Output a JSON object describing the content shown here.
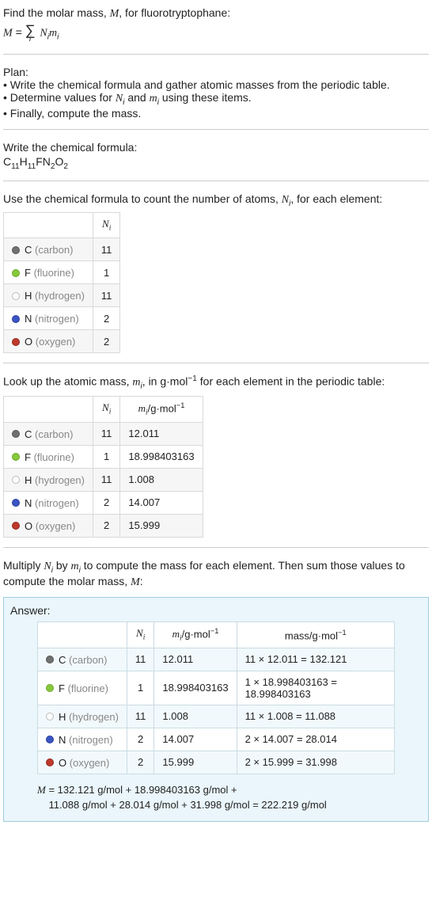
{
  "intro": {
    "line1_pre": "Find the molar mass, ",
    "line1_mid": ", for fluorotryptophane:"
  },
  "plan": {
    "heading": "Plan:",
    "items": [
      "Write the chemical formula and gather atomic masses from the periodic table.",
      "Determine values for Nᵢ and mᵢ using these items.",
      "Finally, compute the mass."
    ]
  },
  "formula_section": {
    "heading": "Write the chemical formula:",
    "formula_parts": [
      "C",
      "11",
      "H",
      "11",
      "F",
      "N",
      "2",
      "O",
      "2"
    ]
  },
  "count_section": {
    "heading_pre": "Use the chemical formula to count the number of atoms, ",
    "heading_post": ", for each element:",
    "headers": {
      "ni": "Nᵢ"
    },
    "rows": [
      {
        "dot": "c",
        "sym": "C",
        "name": "carbon",
        "ni": "11"
      },
      {
        "dot": "f",
        "sym": "F",
        "name": "fluorine",
        "ni": "1"
      },
      {
        "dot": "h",
        "sym": "H",
        "name": "hydrogen",
        "ni": "11"
      },
      {
        "dot": "n",
        "sym": "N",
        "name": "nitrogen",
        "ni": "2"
      },
      {
        "dot": "o",
        "sym": "O",
        "name": "oxygen",
        "ni": "2"
      }
    ]
  },
  "mass_section": {
    "heading_pre": "Look up the atomic mass, ",
    "heading_mid": ", in g·mol",
    "heading_post": " for each element in the periodic table:",
    "headers": {
      "ni": "Nᵢ",
      "mi": "mᵢ/g·mol⁻¹"
    },
    "rows": [
      {
        "dot": "c",
        "sym": "C",
        "name": "carbon",
        "ni": "11",
        "mi": "12.011"
      },
      {
        "dot": "f",
        "sym": "F",
        "name": "fluorine",
        "ni": "1",
        "mi": "18.998403163"
      },
      {
        "dot": "h",
        "sym": "H",
        "name": "hydrogen",
        "ni": "11",
        "mi": "1.008"
      },
      {
        "dot": "n",
        "sym": "N",
        "name": "nitrogen",
        "ni": "2",
        "mi": "14.007"
      },
      {
        "dot": "o",
        "sym": "O",
        "name": "oxygen",
        "ni": "2",
        "mi": "15.999"
      }
    ]
  },
  "multiply_section": {
    "text_pre": "Multiply ",
    "text_mid1": " by ",
    "text_mid2": " to compute the mass for each element. Then sum those values to compute the molar mass, ",
    "text_post": ":"
  },
  "answer": {
    "label": "Answer:",
    "headers": {
      "ni": "Nᵢ",
      "mi": "mᵢ/g·mol⁻¹",
      "mass": "mass/g·mol⁻¹"
    },
    "rows": [
      {
        "dot": "c",
        "sym": "C",
        "name": "carbon",
        "ni": "11",
        "mi": "12.011",
        "mass": "11 × 12.011 = 132.121"
      },
      {
        "dot": "f",
        "sym": "F",
        "name": "fluorine",
        "ni": "1",
        "mi": "18.998403163",
        "mass": "1 × 18.998403163 = 18.998403163"
      },
      {
        "dot": "h",
        "sym": "H",
        "name": "hydrogen",
        "ni": "11",
        "mi": "1.008",
        "mass": "11 × 1.008 = 11.088"
      },
      {
        "dot": "n",
        "sym": "N",
        "name": "nitrogen",
        "ni": "2",
        "mi": "14.007",
        "mass": "2 × 14.007 = 28.014"
      },
      {
        "dot": "o",
        "sym": "O",
        "name": "oxygen",
        "ni": "2",
        "mi": "15.999",
        "mass": "2 × 15.999 = 31.998"
      }
    ],
    "final_line1_pre": " = 132.121 g/mol + 18.998403163 g/mol +",
    "final_line2": "11.088 g/mol + 28.014 g/mol + 31.998 g/mol = 222.219 g/mol"
  }
}
